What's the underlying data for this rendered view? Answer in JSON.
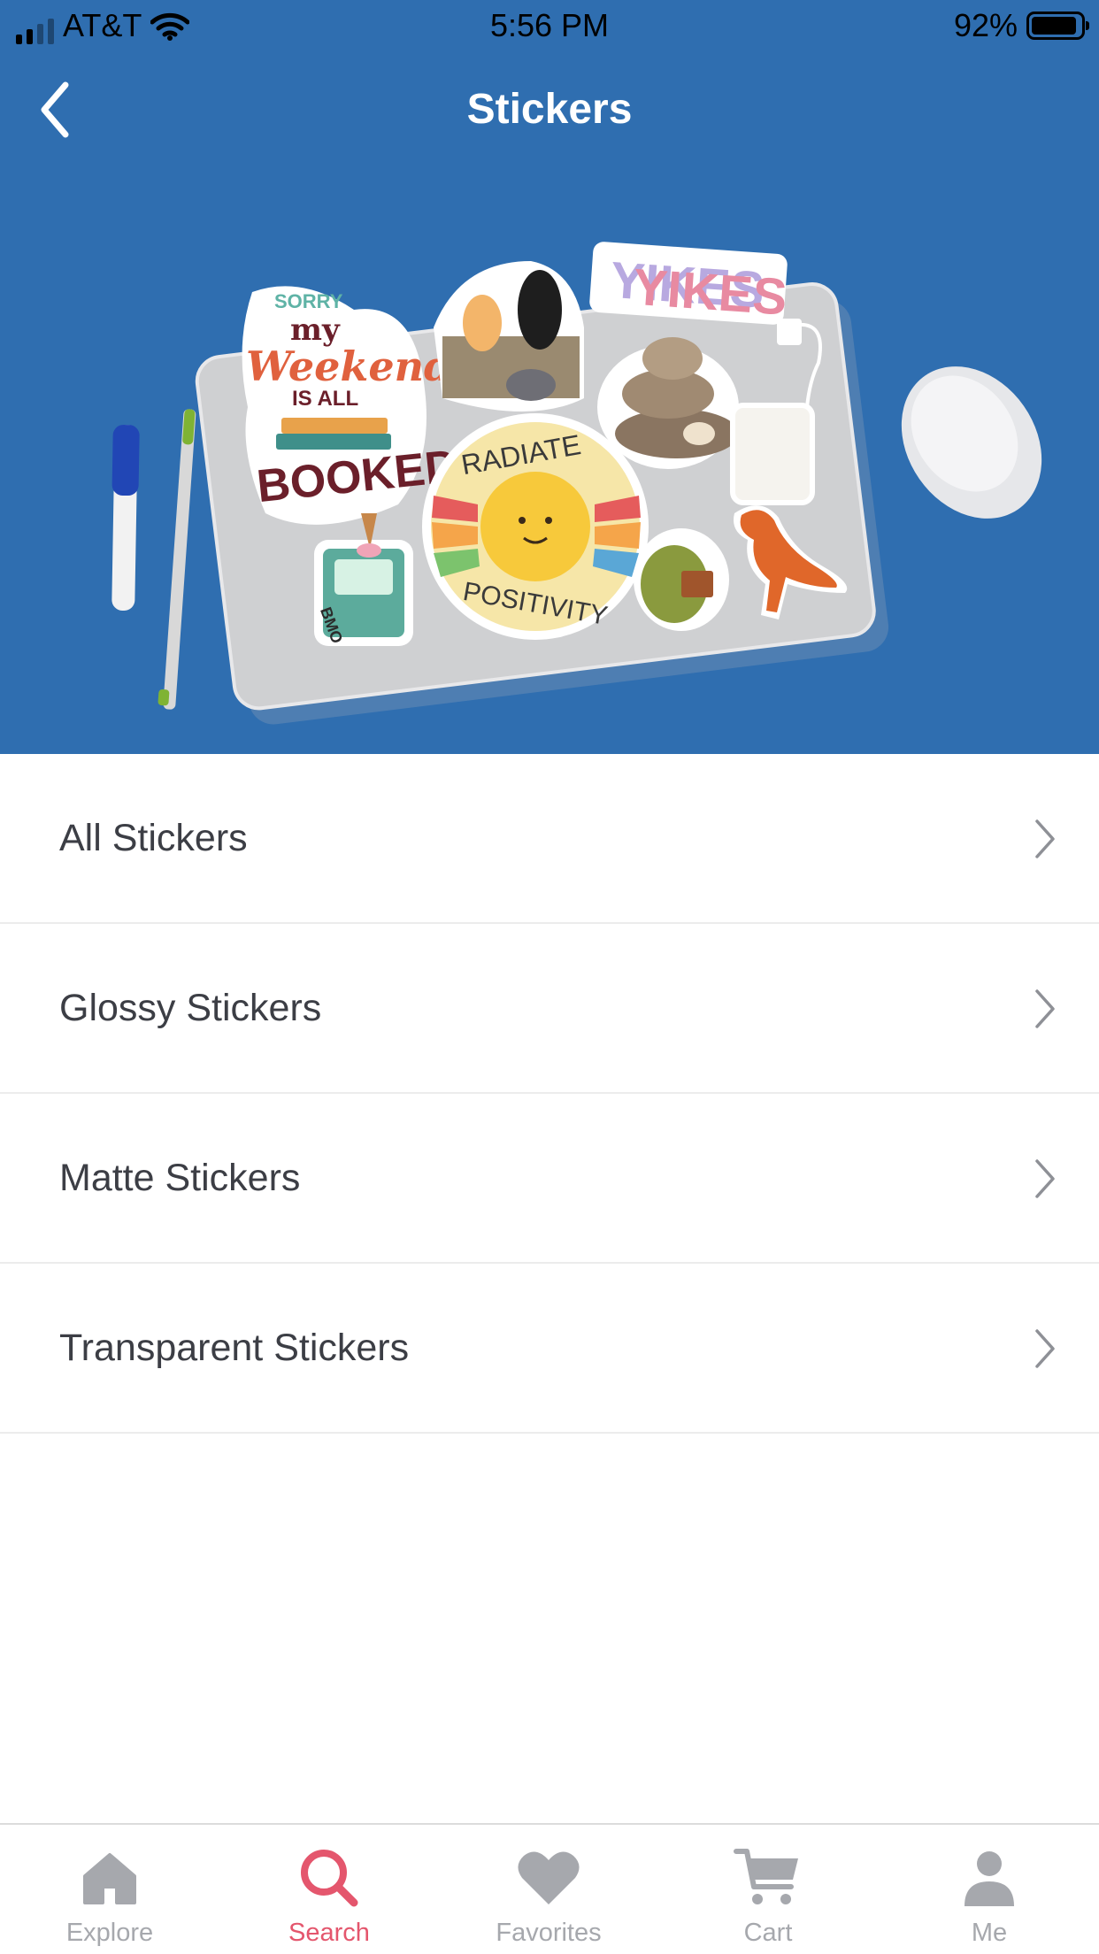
{
  "status_bar": {
    "carrier": "AT&T",
    "time": "5:56 PM",
    "battery_percent": "92%",
    "battery_level": 0.92,
    "signal_bars_filled": 2,
    "signal_bars_total": 4
  },
  "nav": {
    "title": "Stickers",
    "back_icon": "chevron-left-icon"
  },
  "hero": {
    "stickers": {
      "sorry": "SORRY",
      "my": "my",
      "weekend": "Weekend",
      "is_all": "IS ALL",
      "booked": "BOOKED",
      "yikes": "YIKES",
      "radiate": "RADIATE",
      "positivity": "POSITIVITY",
      "bmo": "BMO"
    }
  },
  "categories": [
    {
      "label": "All Stickers"
    },
    {
      "label": "Glossy Stickers"
    },
    {
      "label": "Matte Stickers"
    },
    {
      "label": "Transparent Stickers"
    }
  ],
  "tabbar": {
    "tabs": [
      {
        "label": "Explore",
        "icon": "home-icon",
        "active": false
      },
      {
        "label": "Search",
        "icon": "search-icon",
        "active": true
      },
      {
        "label": "Favorites",
        "icon": "heart-icon",
        "active": false
      },
      {
        "label": "Cart",
        "icon": "cart-icon",
        "active": false
      },
      {
        "label": "Me",
        "icon": "person-icon",
        "active": false
      }
    ]
  },
  "colors": {
    "brand_blue": "#2f6eb0",
    "active_tab": "#e4566d",
    "inactive_tab": "#a6a8ad",
    "row_text": "#3c3e45"
  }
}
